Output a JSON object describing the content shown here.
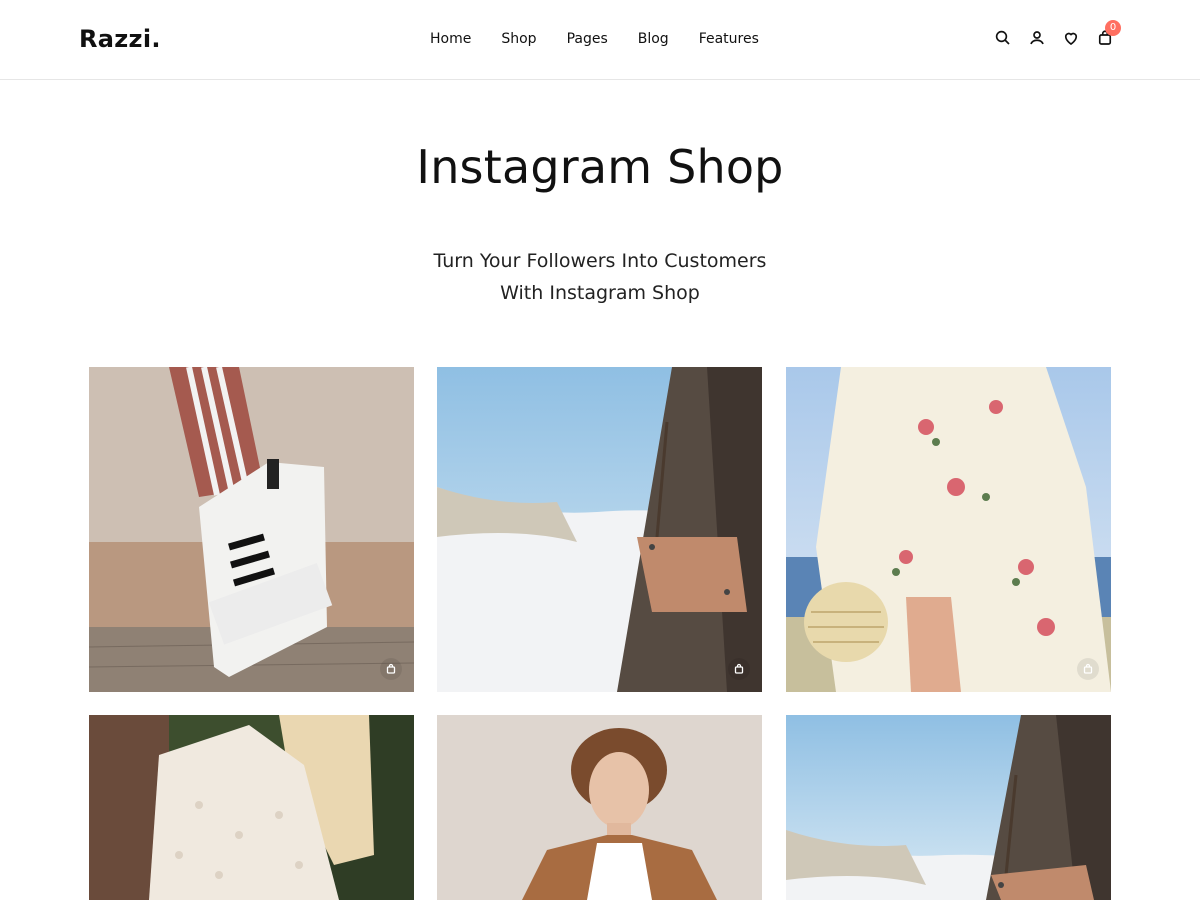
{
  "header": {
    "logo": "Razzi.",
    "nav": [
      "Home",
      "Shop",
      "Pages",
      "Blog",
      "Features"
    ],
    "cart_count": "0"
  },
  "hero": {
    "title": "Instagram Shop",
    "subtitle_line1": "Turn Your Followers Into Customers",
    "subtitle_line2": "With Instagram Shop"
  },
  "gallery": {
    "tiles": [
      {
        "subject": "sneaker-photo"
      },
      {
        "subject": "beach-bag-photo"
      },
      {
        "subject": "floral-dress-photo"
      },
      {
        "subject": "knit-sweater-photo"
      },
      {
        "subject": "man-portrait-photo"
      },
      {
        "subject": "beach-bag-photo-2"
      }
    ]
  },
  "icons": [
    "search-icon",
    "user-icon",
    "heart-icon",
    "cart-icon",
    "bag-icon"
  ],
  "colors": {
    "badge": "#ff6f61",
    "text": "#111111"
  }
}
